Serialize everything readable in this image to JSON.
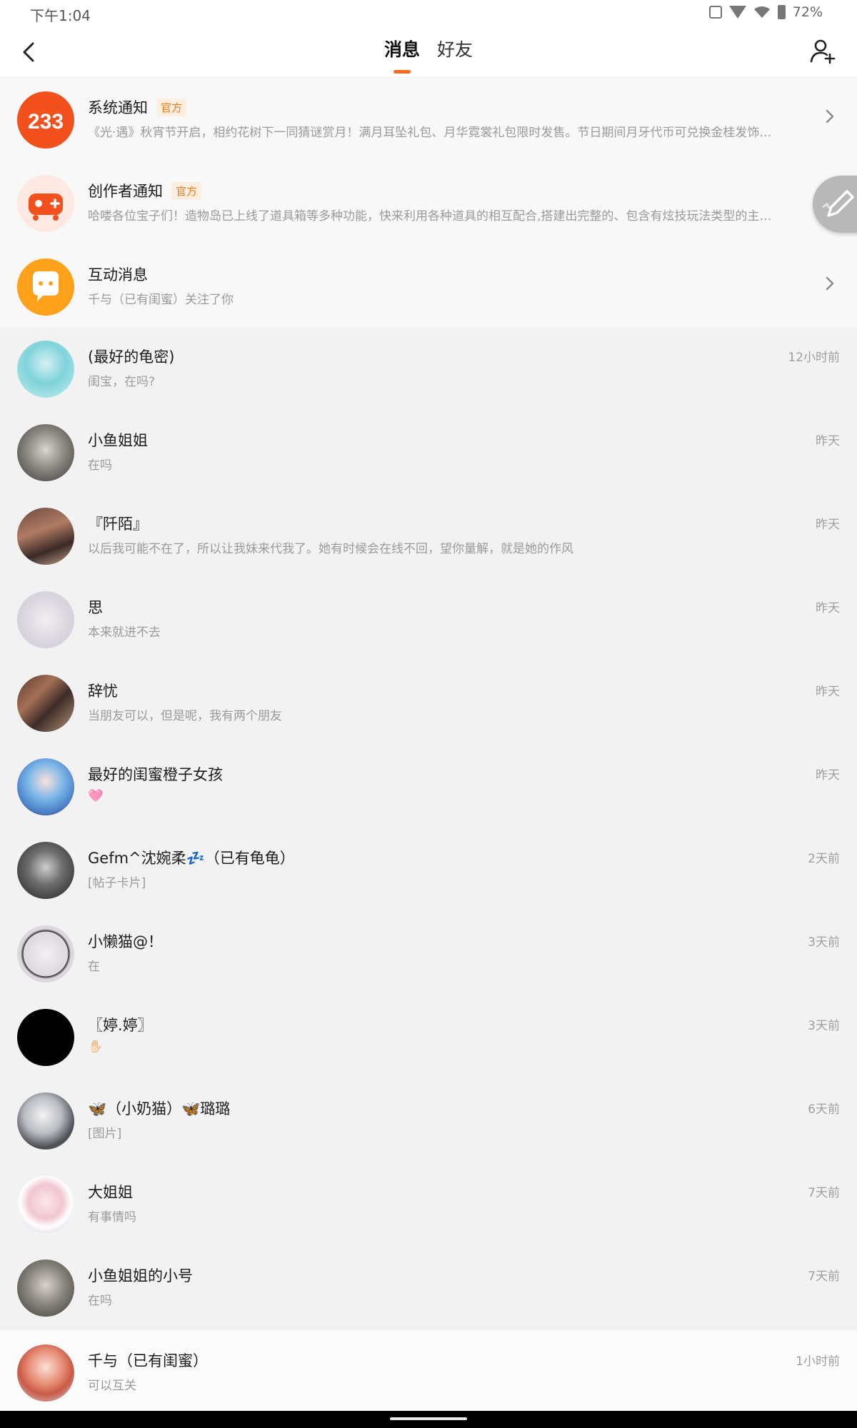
{
  "status_bar": {
    "time": "下午1:04",
    "battery": "72%"
  },
  "nav": {
    "tabs": [
      {
        "label": "消息",
        "active": true
      },
      {
        "label": "好友",
        "active": false
      }
    ],
    "accent_color": "#ff6a1f"
  },
  "notifications": [
    {
      "name": "系统通知",
      "badge": "官方",
      "preview": "《光·遇》秋宵节开启，相约花树下一同猜谜赏月！满月耳坠礼包、月华霓裳礼包限时发售。节日期间月牙代币可兑换金桂发饰…",
      "icon": "233-logo-icon",
      "avatar_text": "233"
    },
    {
      "name": "创作者通知",
      "badge": "官方",
      "preview": "哈喽各位宝子们！造物岛已上线了道具箱等多种功能，快来利用各种道具的相互配合,搭建出完整的、包含有炫技玩法类型的主…",
      "icon": "gamepad-icon"
    },
    {
      "name": "互动消息",
      "preview": "千与（已有闺蜜）关注了你",
      "icon": "chat-bubble-icon"
    }
  ],
  "conversations": [
    {
      "name": "(最好的龟密)",
      "preview": "闺宝，在吗?",
      "time": "12小时前"
    },
    {
      "name": "小鱼姐姐",
      "preview": "在吗",
      "time": "昨天"
    },
    {
      "name": "『阡陌』",
      "preview": "以后我可能不在了，所以让我妹来代我了。她有时候会在线不回，望你量解，就是她的作风",
      "time": "昨天"
    },
    {
      "name": "思",
      "preview": "本来就进不去",
      "time": "昨天"
    },
    {
      "name": "辞忧",
      "preview": "当朋友可以，但是呢，我有两个朋友",
      "time": "昨天"
    },
    {
      "name": "最好的闺蜜橙子女孩",
      "preview": "🩷",
      "time": "昨天"
    },
    {
      "name": "Gefm^沈婉柔💤（已有龟龟）",
      "preview": "[帖子卡片]",
      "time": "2天前"
    },
    {
      "name": "小懒猫@！",
      "preview": "在",
      "time": "3天前"
    },
    {
      "name": "〖婷.婷〗",
      "preview": "✋🏻",
      "time": "3天前"
    },
    {
      "name": "🦋（小奶猫）🦋璐璐",
      "preview": "[图片]",
      "time": "6天前"
    },
    {
      "name": "大姐姐",
      "preview": "有事情吗",
      "time": "7天前"
    },
    {
      "name": "小鱼姐姐的小号",
      "preview": "在吗",
      "time": "7天前"
    }
  ],
  "pinned": {
    "name": "千与（已有闺蜜）",
    "preview": "可以互关",
    "time": "1小时前"
  }
}
